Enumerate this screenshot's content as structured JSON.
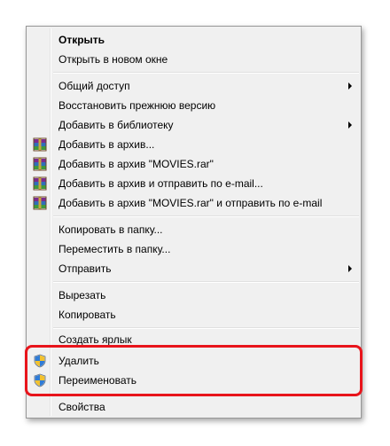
{
  "context_menu": {
    "items": [
      {
        "label": "Открыть",
        "bold": true
      },
      {
        "label": "Открыть в новом окне"
      },
      {
        "label": "Общий доступ",
        "submenu": true
      },
      {
        "label": "Восстановить прежнюю версию"
      },
      {
        "label": "Добавить в библиотеку",
        "submenu": true
      },
      {
        "label": "Добавить в архив...",
        "icon": "winrar-archive-icon"
      },
      {
        "label": "Добавить в архив \"MOVIES.rar\"",
        "icon": "winrar-archive-icon"
      },
      {
        "label": "Добавить в архив и отправить по e-mail...",
        "icon": "winrar-archive-icon"
      },
      {
        "label": "Добавить в архив \"MOVIES.rar\" и отправить по e-mail",
        "icon": "winrar-archive-icon"
      },
      {
        "label": "Копировать в папку..."
      },
      {
        "label": "Переместить в папку..."
      },
      {
        "label": "Отправить",
        "submenu": true
      },
      {
        "label": "Вырезать"
      },
      {
        "label": "Копировать"
      },
      {
        "label": "Создать ярлык"
      },
      {
        "label": "Удалить",
        "icon": "uac-shield-icon"
      },
      {
        "label": "Переименовать",
        "icon": "uac-shield-icon"
      },
      {
        "label": "Свойства"
      }
    ]
  },
  "highlight": {
    "color": "#e8141b"
  }
}
